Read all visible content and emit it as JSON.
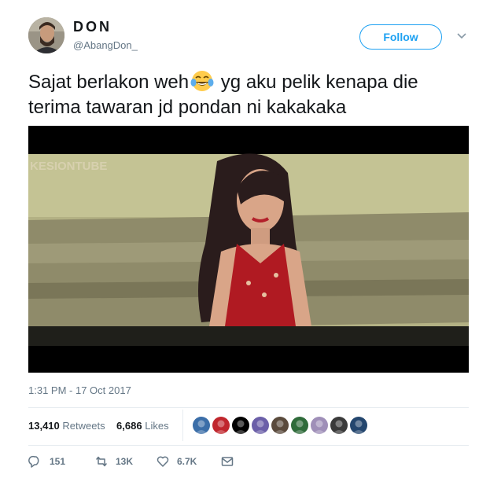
{
  "user": {
    "display_name": "DON",
    "handle": "@AbangDon_",
    "avatar_icon": "profile-photo"
  },
  "follow_label": "Follow",
  "tweet": {
    "text_part1": "Sajat berlakon weh",
    "emoji": "face-with-tears-of-joy",
    "text_part2": " yg aku pelik kenapa die terima tawaran jd pondan ni kakakaka",
    "media": {
      "kind": "video-still",
      "watermark": "KESIONTUBE"
    },
    "timestamp": "1:31 PM - 17 Oct 2017"
  },
  "stats": {
    "retweets_count": "13,410",
    "retweets_label": "Retweets",
    "likes_count": "6,686",
    "likes_label": "Likes"
  },
  "likers": [
    {
      "icon": "liker-avatar",
      "color": "#3b6ea8"
    },
    {
      "icon": "liker-avatar",
      "color": "#c0262d"
    },
    {
      "icon": "liker-avatar",
      "color": "#000000"
    },
    {
      "icon": "liker-avatar",
      "color": "#6b5fa8"
    },
    {
      "icon": "liker-avatar",
      "color": "#5a4a3c"
    },
    {
      "icon": "liker-avatar",
      "color": "#2f6b3a"
    },
    {
      "icon": "liker-avatar",
      "color": "#9f8fb8"
    },
    {
      "icon": "liker-avatar",
      "color": "#3a3a3a"
    },
    {
      "icon": "liker-avatar",
      "color": "#24466e"
    }
  ],
  "actions": {
    "replies": "151",
    "retweets": "13K",
    "likes": "6.7K"
  },
  "colors": {
    "accent": "#1da1f2",
    "secondary_text": "#657786",
    "divider": "#e6ecf0"
  }
}
